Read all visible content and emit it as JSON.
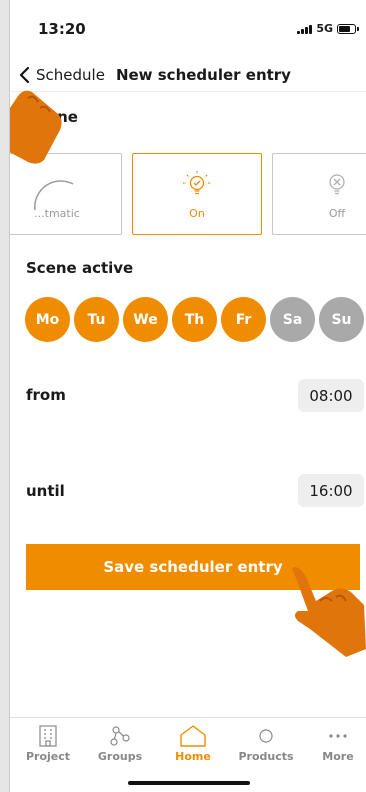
{
  "status_bar": {
    "time": "13:20",
    "network": "5G"
  },
  "nav": {
    "back_label": "Schedule",
    "title": "New scheduler entry"
  },
  "mode_section": {
    "title": "...ne"
  },
  "modes": [
    {
      "label": "...tmatic",
      "icon": "automatic-icon",
      "selected": false
    },
    {
      "label": "On",
      "icon": "bulb-on-icon",
      "selected": true
    },
    {
      "label": "Off",
      "icon": "bulb-off-icon",
      "selected": false
    }
  ],
  "scene_active": {
    "title": "Scene active"
  },
  "days": [
    {
      "label": "Mo",
      "active": true
    },
    {
      "label": "Tu",
      "active": true
    },
    {
      "label": "We",
      "active": true
    },
    {
      "label": "Th",
      "active": true
    },
    {
      "label": "Fr",
      "active": true
    },
    {
      "label": "Sa",
      "active": false
    },
    {
      "label": "Su",
      "active": false
    }
  ],
  "from": {
    "label": "from",
    "value": "08:00"
  },
  "until": {
    "label": "until",
    "value": "16:00"
  },
  "save_button": {
    "label": "Save scheduler entry"
  },
  "tabs": [
    {
      "label": "Project",
      "icon": "building-icon",
      "active": false
    },
    {
      "label": "Groups",
      "icon": "groups-icon",
      "active": false
    },
    {
      "label": "Home",
      "icon": "home-icon",
      "active": true
    },
    {
      "label": "Products",
      "icon": "products-icon",
      "active": false
    },
    {
      "label": "More",
      "icon": "more-icon",
      "active": false
    }
  ],
  "colors": {
    "accent": "#f08c00",
    "inactive_day": "#a9a9a9",
    "tab_inactive": "#888888"
  }
}
